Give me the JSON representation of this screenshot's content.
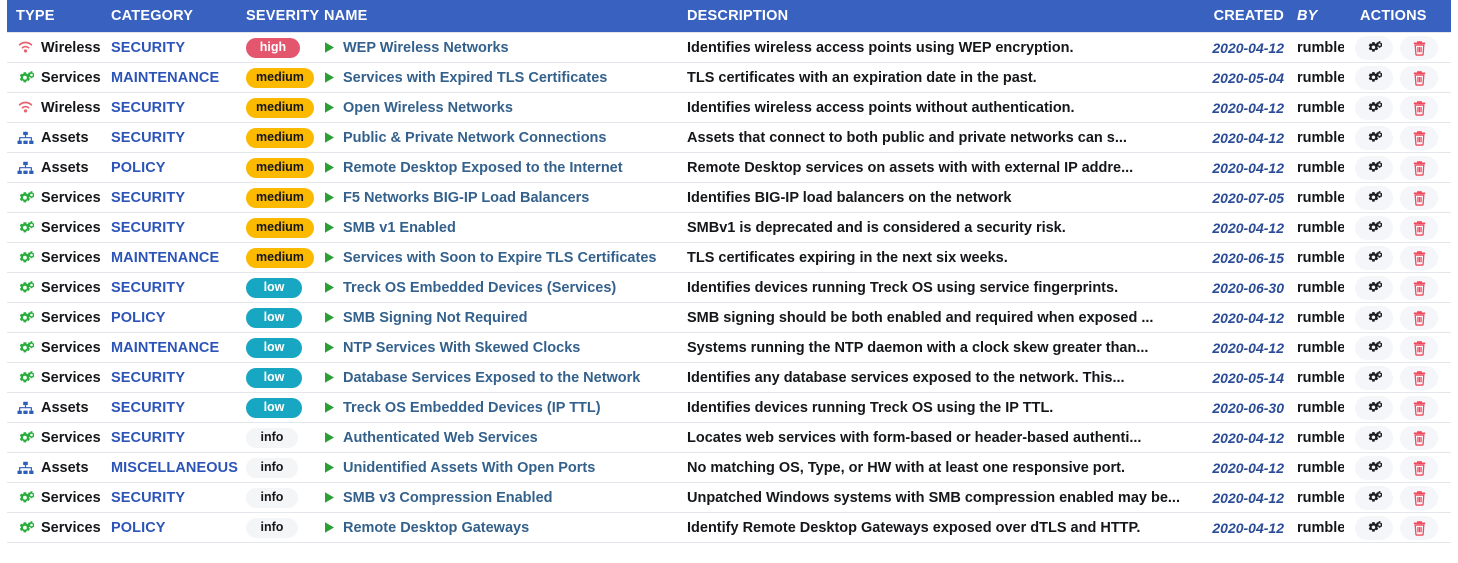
{
  "table": {
    "columns": [
      {
        "key": "type",
        "label": "TYPE"
      },
      {
        "key": "category",
        "label": "CATEGORY"
      },
      {
        "key": "severity",
        "label": "SEVERITY"
      },
      {
        "key": "name",
        "label": "NAME"
      },
      {
        "key": "description",
        "label": "DESCRIPTION"
      },
      {
        "key": "created",
        "label": "CREATED"
      },
      {
        "key": "by",
        "label": "BY"
      },
      {
        "key": "actions",
        "label": "ACTIONS"
      }
    ],
    "header_bg": "#3962c0",
    "severity_colors": {
      "high": "#e3566d",
      "medium": "#fbb900",
      "low": "#18a7c2",
      "info": "#f4f5f7"
    },
    "icons": {
      "wireless": "wifi-icon",
      "services": "gears-icon",
      "assets": "sitemap-icon",
      "name_prefix": "play-triangle-icon",
      "configure": "gears-icon",
      "delete": "trash-icon"
    },
    "rows": [
      {
        "type": "Wireless",
        "type_icon": "wifi-icon",
        "category": "SECURITY",
        "severity": "high",
        "name": "WEP Wireless Networks",
        "description": "Identifies wireless access points using WEP encryption.",
        "created": "2020-04-12",
        "by": "rumble"
      },
      {
        "type": "Services",
        "type_icon": "gears-icon",
        "category": "MAINTENANCE",
        "severity": "medium",
        "name": "Services with Expired TLS Certificates",
        "description": "TLS certificates with an expiration date in the past.",
        "created": "2020-05-04",
        "by": "rumble"
      },
      {
        "type": "Wireless",
        "type_icon": "wifi-icon",
        "category": "SECURITY",
        "severity": "medium",
        "name": "Open Wireless Networks",
        "description": "Identifies wireless access points without authentication.",
        "created": "2020-04-12",
        "by": "rumble"
      },
      {
        "type": "Assets",
        "type_icon": "sitemap-icon",
        "category": "SECURITY",
        "severity": "medium",
        "name": "Public & Private Network Connections",
        "description": "Assets that connect to both public and private networks can s...",
        "created": "2020-04-12",
        "by": "rumble"
      },
      {
        "type": "Assets",
        "type_icon": "sitemap-icon",
        "category": "POLICY",
        "severity": "medium",
        "name": "Remote Desktop Exposed to the Internet",
        "description": "Remote Desktop services on assets with with external IP addre...",
        "created": "2020-04-12",
        "by": "rumble"
      },
      {
        "type": "Services",
        "type_icon": "gears-icon",
        "category": "SECURITY",
        "severity": "medium",
        "name": "F5 Networks BIG-IP Load Balancers",
        "description": "Identifies BIG-IP load balancers on the network",
        "created": "2020-07-05",
        "by": "rumble"
      },
      {
        "type": "Services",
        "type_icon": "gears-icon",
        "category": "SECURITY",
        "severity": "medium",
        "name": "SMB v1 Enabled",
        "description": "SMBv1 is deprecated and is considered a security risk.",
        "created": "2020-04-12",
        "by": "rumble"
      },
      {
        "type": "Services",
        "type_icon": "gears-icon",
        "category": "MAINTENANCE",
        "severity": "medium",
        "name": "Services with Soon to Expire TLS Certificates",
        "description": "TLS certificates expiring in the next six weeks.",
        "created": "2020-06-15",
        "by": "rumble"
      },
      {
        "type": "Services",
        "type_icon": "gears-icon",
        "category": "SECURITY",
        "severity": "low",
        "name": "Treck OS Embedded Devices (Services)",
        "description": "Identifies devices running Treck OS using service fingerprints.",
        "created": "2020-06-30",
        "by": "rumble"
      },
      {
        "type": "Services",
        "type_icon": "gears-icon",
        "category": "POLICY",
        "severity": "low",
        "name": "SMB Signing Not Required",
        "description": "SMB signing should be both enabled and required when exposed ...",
        "created": "2020-04-12",
        "by": "rumble"
      },
      {
        "type": "Services",
        "type_icon": "gears-icon",
        "category": "MAINTENANCE",
        "severity": "low",
        "name": "NTP Services With Skewed Clocks",
        "description": "Systems running the NTP daemon with a clock skew greater than...",
        "created": "2020-04-12",
        "by": "rumble"
      },
      {
        "type": "Services",
        "type_icon": "gears-icon",
        "category": "SECURITY",
        "severity": "low",
        "name": "Database Services Exposed to the Network",
        "description": "Identifies any database services exposed to the network. This...",
        "created": "2020-05-14",
        "by": "rumble"
      },
      {
        "type": "Assets",
        "type_icon": "sitemap-icon",
        "category": "SECURITY",
        "severity": "low",
        "name": "Treck OS Embedded Devices (IP TTL)",
        "description": "Identifies devices running Treck OS using the IP TTL.",
        "created": "2020-06-30",
        "by": "rumble"
      },
      {
        "type": "Services",
        "type_icon": "gears-icon",
        "category": "SECURITY",
        "severity": "info",
        "name": "Authenticated Web Services",
        "description": "Locates web services with form-based or header-based authenti...",
        "created": "2020-04-12",
        "by": "rumble"
      },
      {
        "type": "Assets",
        "type_icon": "sitemap-icon",
        "category": "MISCELLANEOUS",
        "severity": "info",
        "name": "Unidentified Assets With Open Ports",
        "description": "No matching OS, Type, or HW with at least one responsive port.",
        "created": "2020-04-12",
        "by": "rumble"
      },
      {
        "type": "Services",
        "type_icon": "gears-icon",
        "category": "SECURITY",
        "severity": "info",
        "name": "SMB v3 Compression Enabled",
        "description": "Unpatched Windows systems with SMB compression enabled may be...",
        "created": "2020-04-12",
        "by": "rumble"
      },
      {
        "type": "Services",
        "type_icon": "gears-icon",
        "category": "POLICY",
        "severity": "info",
        "name": "Remote Desktop Gateways",
        "description": "Identify Remote Desktop Gateways exposed over dTLS and HTTP.",
        "created": "2020-04-12",
        "by": "rumble"
      }
    ]
  }
}
